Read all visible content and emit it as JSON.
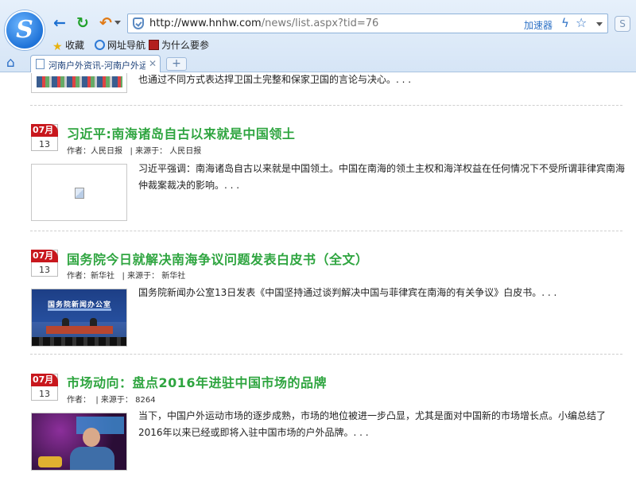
{
  "browser": {
    "url_host": "http://www.hnhw.com",
    "url_path": "/news/list.aspx?tid=76",
    "accelerator_label": "加速器",
    "bookmarks": [
      {
        "label": "收藏",
        "icon": "star-icon"
      },
      {
        "label": "网址导航",
        "icon": "globe-icon"
      },
      {
        "label": "为什么要参",
        "icon": "site-favicon"
      }
    ],
    "tab_title": "河南户外资讯-河南户外运动",
    "new_tab_label": "+"
  },
  "articles": [
    {
      "summary": "也通过不同方式表达捍卫国土完整和保家卫国的言论与决心。. . ."
    },
    {
      "month": "07月",
      "day": "13",
      "title": "习近平:南海诸岛自古以来就是中国领土",
      "author_label": "作者：",
      "author": "人民日报",
      "source_label": "| 来源于：",
      "source": "人民日报",
      "summary": "习近平强调：南海诸岛自古以来就是中国领土。中国在南海的领土主权和海洋权益在任何情况下不受所谓菲律宾南海仲裁案裁决的影响。. . ."
    },
    {
      "month": "07月",
      "day": "13",
      "title": "国务院今日就解决南海争议问题发表白皮书（全文）",
      "author_label": "作者：",
      "author": "新华社",
      "source_label": "| 来源于：",
      "source": "新华社",
      "thumb_sign": "国务院新闻办公室",
      "summary": "国务院新闻办公室13日发表《中国坚持通过谈判解决中国与菲律宾在南海的有关争议》白皮书。. . ."
    },
    {
      "month": "07月",
      "day": "13",
      "title": "市场动向：盘点2016年进驻中国市场的品牌",
      "author_label": "作者：",
      "author": "",
      "source_label": "| 来源于：",
      "source": "8264",
      "summary": "当下，中国户外运动市场的逐步成熟，市场的地位被进一步凸显，尤其是面对中国新的市场增长点。小编总结了2016年以来已经或即将入驻中国市场的户外品牌。. . ."
    }
  ],
  "colors": {
    "title_green": "#2fa540",
    "badge_red": "#c8171d",
    "link_blue": "#2f72c6"
  }
}
